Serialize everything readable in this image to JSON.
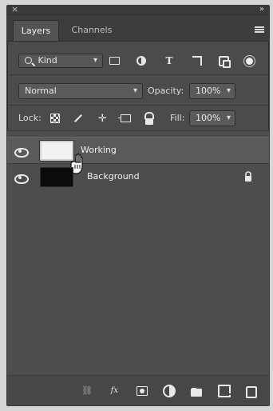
{
  "panel": {
    "tabs": [
      {
        "label": "Layers",
        "active": true
      },
      {
        "label": "Channels",
        "active": false
      }
    ],
    "filter": {
      "kind_value": "Kind",
      "kind_icon": "search-icon"
    },
    "blend": {
      "mode_value": "Normal",
      "opacity_label": "Opacity:",
      "opacity_value": "100%"
    },
    "lock": {
      "label": "Lock:",
      "fill_label": "Fill:",
      "fill_value": "100%"
    },
    "layers": [
      {
        "name": "Working",
        "thumbnail": "white",
        "selected": true
      },
      {
        "name": "Background",
        "thumbnail": "black",
        "selected": false,
        "locked": true
      }
    ]
  },
  "colors": {
    "panel_bg": "#4b4b4b",
    "tab_bar_bg": "#3d3d3d",
    "selected_row_bg": "#5a5a5a",
    "text_light": "#f0f0f0"
  }
}
